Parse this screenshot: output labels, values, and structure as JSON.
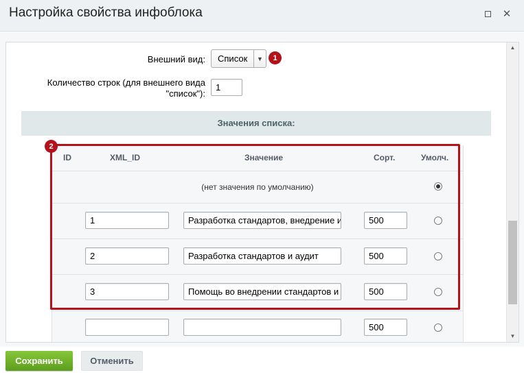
{
  "dialog": {
    "title": "Настройка свойства инфоблока"
  },
  "form": {
    "view_label": "Внешний вид:",
    "view_value": "Список",
    "rows_label_line1": "Количество строк (для внешнего вида",
    "rows_label_line2": "\"список\"):",
    "rows_value": "1",
    "section_title": "Значения списка:"
  },
  "badges": [
    "1",
    "2"
  ],
  "table": {
    "headers": {
      "id": "ID",
      "xml_id": "XML_ID",
      "value": "Значение",
      "sort": "Сорт.",
      "default": "Умолч."
    },
    "no_default_text": "(нет значения по умолчанию)",
    "rows": [
      {
        "xml_id": "1",
        "value": "Разработка стандартов, внедрение и",
        "sort": "500"
      },
      {
        "xml_id": "2",
        "value": "Разработка стандартов и аудит",
        "sort": "500"
      },
      {
        "xml_id": "3",
        "value": "Помощь во внедрении стандартов и",
        "sort": "500"
      },
      {
        "xml_id": "",
        "value": "",
        "sort": "500"
      }
    ]
  },
  "buttons": {
    "save": "Сохранить",
    "cancel": "Отменить"
  },
  "colors": {
    "accent_red": "#b3121b",
    "save_green": "#6cb02a",
    "section_bg": "#e0e8ea"
  }
}
